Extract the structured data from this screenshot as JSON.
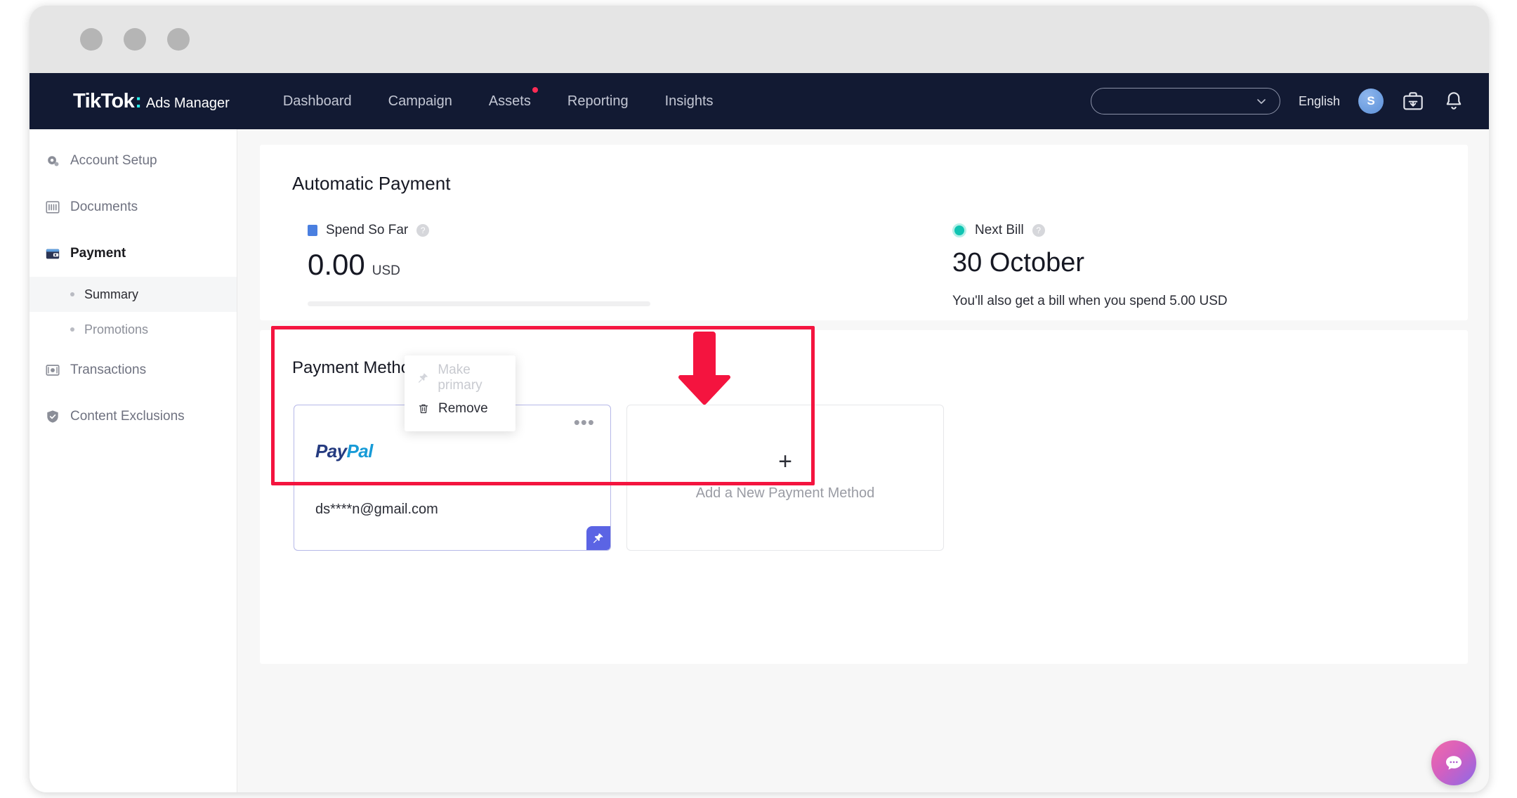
{
  "window": {
    "dots": [
      "window-dot-1",
      "window-dot-2",
      "window-dot-3"
    ]
  },
  "topnav": {
    "brand_name": "TikTok",
    "brand_colon": ":",
    "brand_product": "Ads Manager",
    "links": [
      {
        "label": "Dashboard",
        "badge": false
      },
      {
        "label": "Campaign",
        "badge": false
      },
      {
        "label": "Assets",
        "badge": true
      },
      {
        "label": "Reporting",
        "badge": false
      },
      {
        "label": "Insights",
        "badge": false
      }
    ],
    "account_select_value": "",
    "language_label": "English",
    "avatar_initial": "S",
    "icons": [
      "briefcase-icon",
      "bell-icon"
    ],
    "colors": {
      "bar_bg": "#121a33",
      "accent_teal": "#25f4ee",
      "accent_pink": "#fe2c55"
    }
  },
  "sidebar": {
    "items": [
      {
        "label": "Account Setup",
        "icon": "settings-gear-icon",
        "active": false
      },
      {
        "label": "Documents",
        "icon": "documents-icon",
        "active": false
      },
      {
        "label": "Payment",
        "icon": "wallet-icon",
        "active": true
      },
      {
        "label": "Transactions",
        "icon": "transactions-icon",
        "active": false
      },
      {
        "label": "Content Exclusions",
        "icon": "shield-icon",
        "active": false
      }
    ],
    "subitems": [
      {
        "label": "Summary",
        "selected": true
      },
      {
        "label": "Promotions",
        "selected": false
      }
    ]
  },
  "automatic_payment": {
    "title": "Automatic Payment",
    "spend": {
      "label": "Spend So Far",
      "amount": "0.00",
      "currency": "USD",
      "progress_percent": 0,
      "marker_color": "#4a7fe0"
    },
    "next_bill": {
      "label": "Next Bill",
      "date": "30 October",
      "note": "You'll also get a bill when you spend 5.00 USD",
      "marker_color": "#10c4b2"
    }
  },
  "payment_methods": {
    "title": "Payment Methods",
    "paypal_card": {
      "brand_part1": "Pay",
      "brand_part2": "Pal",
      "masked_email": "ds****n@gmail.com",
      "more_glyph": "•••",
      "primary_badge_icon": "pin-icon"
    },
    "menu": {
      "items": [
        {
          "label": "Make primary",
          "icon": "pin-icon",
          "disabled": true
        },
        {
          "label": "Remove",
          "icon": "trash-icon",
          "disabled": false
        }
      ]
    },
    "add_card": {
      "plus_glyph": "+",
      "label": "Add a New Payment Method"
    }
  },
  "annotations": {
    "highlight_box_color": "#f4143f",
    "arrow_color": "#f4143f"
  },
  "chat_widget": {
    "icon": "chat-bubble-icon"
  }
}
